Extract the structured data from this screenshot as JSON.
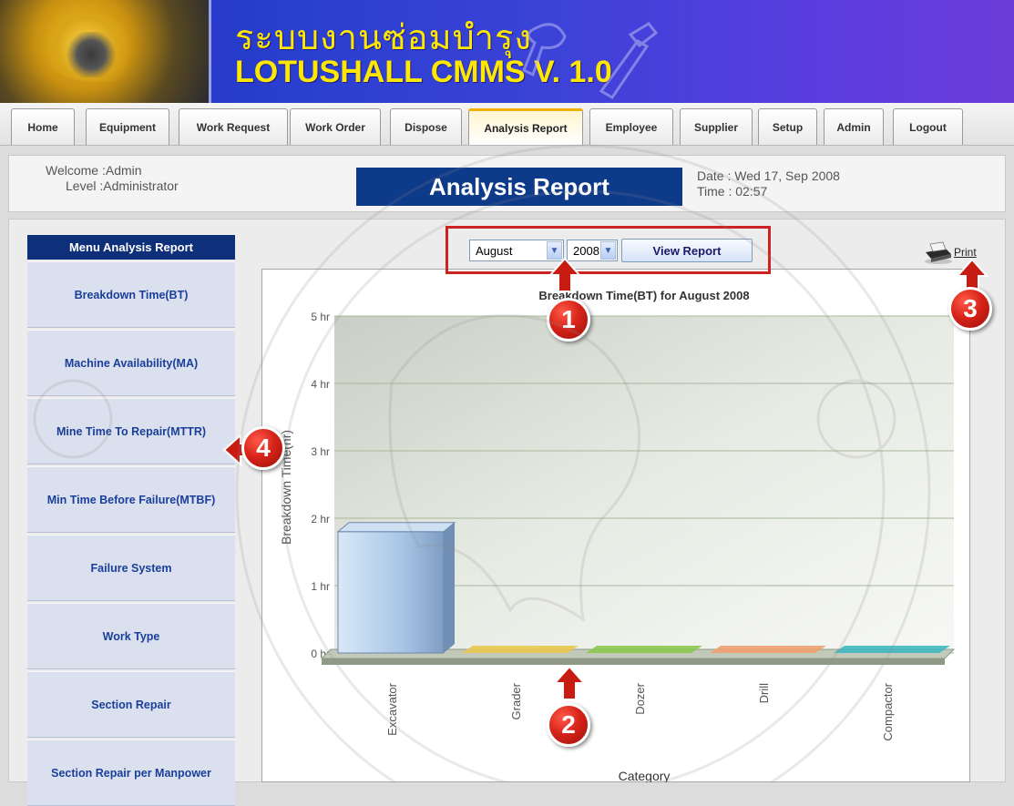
{
  "header": {
    "title_thai": "ระบบงานซ่อมบำรุง",
    "title_en": "LOTUSHALL CMMS V. 1.0"
  },
  "nav": {
    "tabs": [
      {
        "label": "Home"
      },
      {
        "label": "Equipment"
      },
      {
        "label": "Work Request"
      },
      {
        "label": "Work Order"
      },
      {
        "label": "Dispose"
      },
      {
        "label": "Analysis Report",
        "active": true
      },
      {
        "label": "Employee"
      },
      {
        "label": "Supplier"
      },
      {
        "label": "Setup"
      },
      {
        "label": "Admin"
      },
      {
        "label": "Logout"
      }
    ]
  },
  "welcome": {
    "user": "Welcome :Admin",
    "level": "Level :Administrator",
    "page_title": "Analysis Report",
    "date": "Date : Wed 17, Sep 2008",
    "time": "Time : 02:57"
  },
  "sidebar": {
    "header": "Menu Analysis Report",
    "items": [
      {
        "label": "Breakdown Time(BT)"
      },
      {
        "label": "Machine Availability(MA)"
      },
      {
        "label": "Mine Time To Repair(MTTR)"
      },
      {
        "label": "Min Time Before Failure(MTBF)"
      },
      {
        "label": "Failure System"
      },
      {
        "label": "Work Type"
      },
      {
        "label": "Section Repair"
      },
      {
        "label": "Section Repair per Manpower"
      }
    ]
  },
  "controls": {
    "month": "August",
    "year": "2008",
    "view_button": "View Report",
    "print_label": "Print"
  },
  "annotations": [
    "1",
    "2",
    "3",
    "4"
  ],
  "colors": {
    "accent_blue": "#0e3a8a",
    "annotation_red": "#d8241a",
    "active_tab": "#f0b000"
  },
  "chart_data": {
    "type": "bar",
    "title": "Breakdown Time(BT) for August 2008",
    "xlabel": "Category",
    "ylabel": "Breakdown Time(hr)",
    "categories": [
      "Excavator",
      "Grader",
      "Dozer",
      "Drill",
      "Compactor"
    ],
    "values": [
      1.8,
      0,
      0,
      0,
      0
    ],
    "y_ticks": [
      "0 hr",
      "1 hr",
      "2 hr",
      "3 hr",
      "4 hr",
      "5 hr"
    ],
    "ylim": [
      0,
      5
    ],
    "bar_colors": [
      "#aac6e6",
      "#e8c850",
      "#8cc850",
      "#f0a070",
      "#40b8c0"
    ],
    "grid": true
  }
}
